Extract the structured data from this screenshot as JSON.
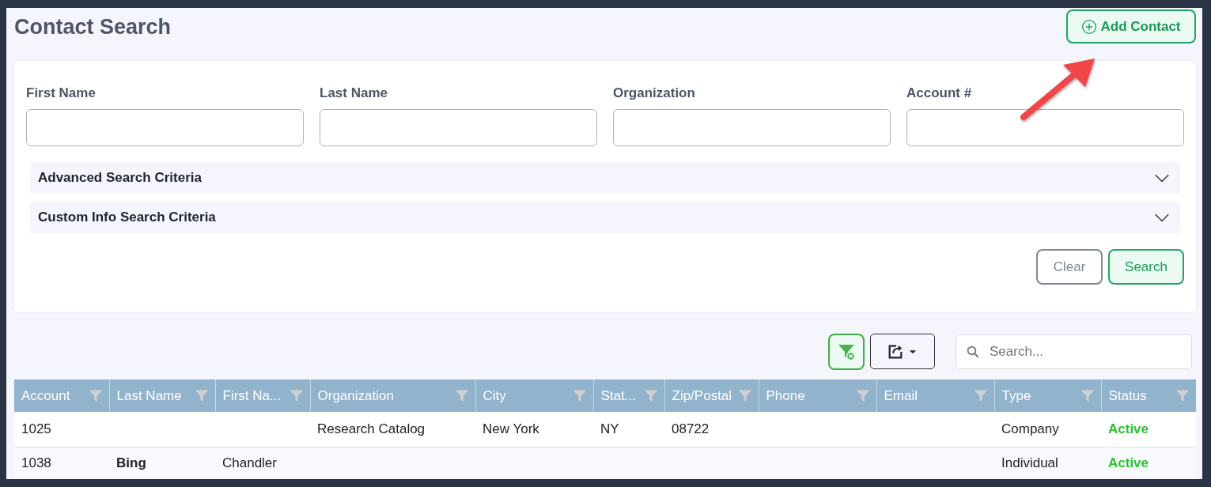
{
  "page": {
    "title": "Contact Search",
    "add_button": "Add Contact"
  },
  "search_form": {
    "fields": [
      {
        "label": "First Name"
      },
      {
        "label": "Last Name"
      },
      {
        "label": "Organization"
      },
      {
        "label": "Account #"
      }
    ],
    "sections": [
      {
        "label": "Advanced Search Criteria",
        "expanded": false
      },
      {
        "label": "Custom Info Search Criteria",
        "expanded": false
      }
    ],
    "buttons": [
      {
        "label": "Clear",
        "kind": "secondary"
      },
      {
        "label": "Search",
        "kind": "primary"
      }
    ]
  },
  "toolbar": {
    "search": {
      "placeholder": "Search..."
    }
  },
  "table": {
    "columns": [
      {
        "label": "Account",
        "kind": "text"
      },
      {
        "label": "Last Name",
        "kind": "bold"
      },
      {
        "label": "First Na...",
        "kind": "text"
      },
      {
        "label": "Organization",
        "kind": "text"
      },
      {
        "label": "City",
        "kind": "text"
      },
      {
        "label": "Stat...",
        "kind": "text"
      },
      {
        "label": "Zip/Postal",
        "kind": "text"
      },
      {
        "label": "Phone",
        "kind": "text"
      },
      {
        "label": "Email",
        "kind": "text"
      },
      {
        "label": "Type",
        "kind": "text"
      },
      {
        "label": "Status",
        "kind": "status"
      }
    ],
    "rows": [
      {
        "cells": [
          "1025",
          "",
          "",
          "Research Catalog",
          "New York",
          "NY",
          "08722",
          "",
          "",
          "Company",
          "Active"
        ]
      },
      {
        "cells": [
          "1038",
          "Bing",
          "Chandler",
          "",
          "",
          "",
          "",
          "",
          "",
          "Individual",
          "Active"
        ]
      }
    ]
  }
}
